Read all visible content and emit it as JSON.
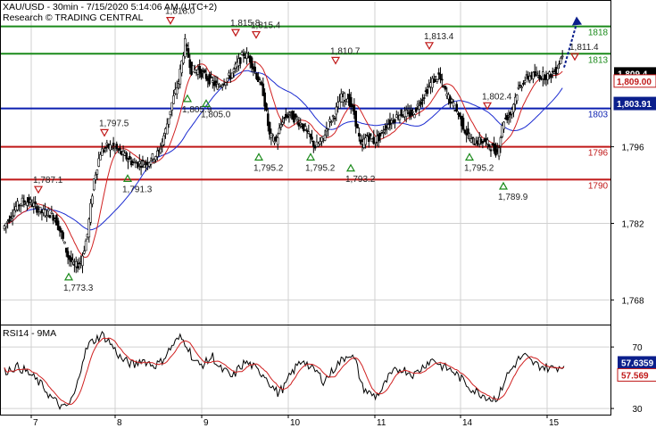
{
  "header": {
    "line1": "XAU/USD - 30min - 7/15/2020 5:14:06 AM (UTC+2)",
    "line2": "Research © TRADING CENTRAL"
  },
  "colors": {
    "green": "#1a8a1a",
    "blue": "#0b1fb0",
    "red": "#c01818",
    "navy": "#0b1f8c",
    "candle": "#000000",
    "ma_red": "#d02020",
    "ma_blue": "#1a2ad0",
    "grid": "#d0d0d0"
  },
  "chart_data": [
    {
      "type": "line",
      "title": "XAU/USD - 30min",
      "y_ticks": [
        1768,
        1782,
        1796
      ],
      "ylim": [
        1763.5,
        1822.5
      ],
      "x_ticks": [
        "7",
        "8",
        "9",
        "10",
        "11",
        "14",
        "15"
      ],
      "levels": [
        {
          "value": 1818,
          "label": "1818",
          "color": "green"
        },
        {
          "value": 1813,
          "label": "1813",
          "color": "green"
        },
        {
          "value": 1803,
          "label": "1803",
          "color": "blue"
        },
        {
          "value": 1796,
          "label": "1796",
          "color": "red"
        },
        {
          "value": 1790,
          "label": "1790",
          "color": "red"
        }
      ],
      "last_price": {
        "value": 1809.4,
        "label": "1,809.4"
      },
      "tags": [
        {
          "value": 1809.0,
          "label": "1,809.00",
          "color": "red"
        },
        {
          "value": 1803.91,
          "label": "1,803.91",
          "color": "navy"
        }
      ],
      "annotations": [
        {
          "x": "7",
          "label": "1,787.1",
          "value": 1787.1,
          "kind": "high"
        },
        {
          "x": "7",
          "label": "1,773.3",
          "value": 1773.3,
          "kind": "low"
        },
        {
          "x": "8",
          "label": "1,797.5",
          "value": 1797.5,
          "kind": "high"
        },
        {
          "x": "8",
          "label": "1,791.3",
          "value": 1791.3,
          "kind": "low"
        },
        {
          "x": "9",
          "label": "1,818.0",
          "value": 1818.0,
          "kind": "high"
        },
        {
          "x": "9",
          "label": "1,805.9",
          "value": 1805.9,
          "kind": "low"
        },
        {
          "x": "9",
          "label": "1,805.0",
          "value": 1805.0,
          "kind": "low"
        },
        {
          "x": "9",
          "label": "1,815.8",
          "value": 1815.8,
          "kind": "high"
        },
        {
          "x": "9",
          "label": "1,815.4",
          "value": 1815.4,
          "kind": "high"
        },
        {
          "x": "10",
          "label": "1,795.2",
          "value": 1795.2,
          "kind": "low"
        },
        {
          "x": "10",
          "label": "1,795.2",
          "value": 1795.2,
          "kind": "low"
        },
        {
          "x": "10",
          "label": "1,810.7",
          "value": 1810.7,
          "kind": "high"
        },
        {
          "x": "11",
          "label": "1,793.2",
          "value": 1793.2,
          "kind": "low"
        },
        {
          "x": "11",
          "label": "1,813.4",
          "value": 1813.4,
          "kind": "high"
        },
        {
          "x": "14",
          "label": "1,795.2",
          "value": 1795.2,
          "kind": "low"
        },
        {
          "x": "14",
          "label": "1,802.4",
          "value": 1802.4,
          "kind": "high"
        },
        {
          "x": "14",
          "label": "1,789.9",
          "value": 1789.9,
          "kind": "low"
        },
        {
          "x": "15",
          "label": "1,811.4",
          "value": 1811.4,
          "kind": "high"
        }
      ],
      "price_series": [
        1781,
        1783,
        1785,
        1786,
        1786,
        1785,
        1784,
        1784,
        1783,
        1780,
        1776,
        1774,
        1775,
        1780,
        1790,
        1795,
        1796,
        1796,
        1795,
        1794,
        1793,
        1793,
        1793,
        1794,
        1795,
        1799,
        1804,
        1808,
        1815,
        1810,
        1810,
        1809,
        1808,
        1807,
        1808,
        1809,
        1811,
        1813,
        1812,
        1809,
        1806,
        1798,
        1797,
        1801,
        1802,
        1801,
        1800,
        1798,
        1796,
        1797,
        1800,
        1802,
        1805,
        1805,
        1802,
        1796,
        1798,
        1797,
        1798,
        1800,
        1801,
        1802,
        1802,
        1802,
        1804,
        1806,
        1808,
        1809,
        1806,
        1804,
        1802,
        1799,
        1797,
        1797,
        1797,
        1796,
        1795,
        1801,
        1802,
        1806,
        1808,
        1809,
        1809,
        1809,
        1809,
        1810,
        1813
      ]
    },
    {
      "type": "line",
      "title": "RSI14 - 9MA",
      "y_ticks": [
        30,
        70
      ],
      "ylim": [
        26,
        84
      ],
      "last_value": {
        "value": 57.6359,
        "label": "57.6359"
      },
      "tag": {
        "value": 57.569,
        "label": "57.569",
        "color": "red"
      },
      "rsi_series": [
        54,
        56,
        57,
        55,
        52,
        48,
        44,
        38,
        34,
        30,
        33,
        42,
        62,
        72,
        75,
        78,
        74,
        68,
        62,
        60,
        58,
        62,
        60,
        58,
        60,
        66,
        72,
        76,
        72,
        62,
        58,
        60,
        64,
        56,
        54,
        50,
        56,
        60,
        58,
        54,
        52,
        45,
        40,
        44,
        52,
        58,
        62,
        56,
        54,
        48,
        52,
        58,
        62,
        66,
        60,
        44,
        40,
        38,
        42,
        50,
        54,
        56,
        54,
        52,
        56,
        60,
        62,
        58,
        56,
        54,
        50,
        46,
        42,
        40,
        38,
        36,
        38,
        50,
        56,
        62,
        64,
        60,
        58,
        57,
        56,
        57,
        57.6
      ]
    }
  ]
}
